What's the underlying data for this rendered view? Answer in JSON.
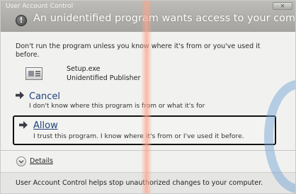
{
  "window": {
    "title": "User Account Control",
    "close_label": "✕"
  },
  "header": {
    "icon": "shield-warning-icon",
    "icon_glyph": "!",
    "title": "An unidentified program wants access to your computer"
  },
  "warning_text": "Don't run the program unless you know where it's from or you've used it before.",
  "program": {
    "icon": "program-icon",
    "name": "Setup.exe",
    "publisher": "Unidentified Publisher"
  },
  "options": {
    "cancel": {
      "icon": "arrow-right-icon",
      "label": "Cancel",
      "description": "I don't know where this program is from or what it's for"
    },
    "allow": {
      "icon": "arrow-right-icon",
      "label": "Allow",
      "description": "I trust this program. I know where it's from or I've used it before."
    }
  },
  "details": {
    "icon": "chevron-down-icon",
    "label": "Details"
  },
  "footer_text": "User Account Control helps stop unauthorized changes to your computer.",
  "colors": {
    "title_bar": "#afaeaa",
    "link_blue": "#1f3f7a",
    "background": "#f1f2f0",
    "selection_border": "#111111"
  }
}
